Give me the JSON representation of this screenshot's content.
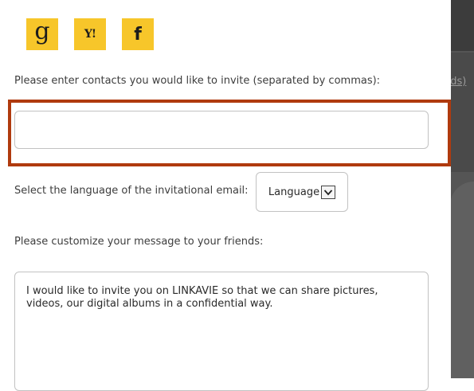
{
  "background": {
    "partial_link": "nds)"
  },
  "providers": [
    {
      "name": "google-icon",
      "glyph": "g"
    },
    {
      "name": "yahoo-icon",
      "glyph": "Y!"
    },
    {
      "name": "facebook-icon",
      "glyph": "f"
    }
  ],
  "invite": {
    "contacts_label": "Please enter contacts you would like to invite (separated by commas):",
    "contacts_value": "",
    "language_label": "Select the language of the invitational email:",
    "language_value": "Language",
    "message_label": "Please customize your message to your friends:",
    "message_value": "I would like to invite you on LINKAVIE so that we can share pictures,\nvideos, our digital albums in a confidential way."
  },
  "colors": {
    "provider_bg": "#f7c62a",
    "highlight_border": "#b03a0e",
    "backdrop": "#555555"
  }
}
